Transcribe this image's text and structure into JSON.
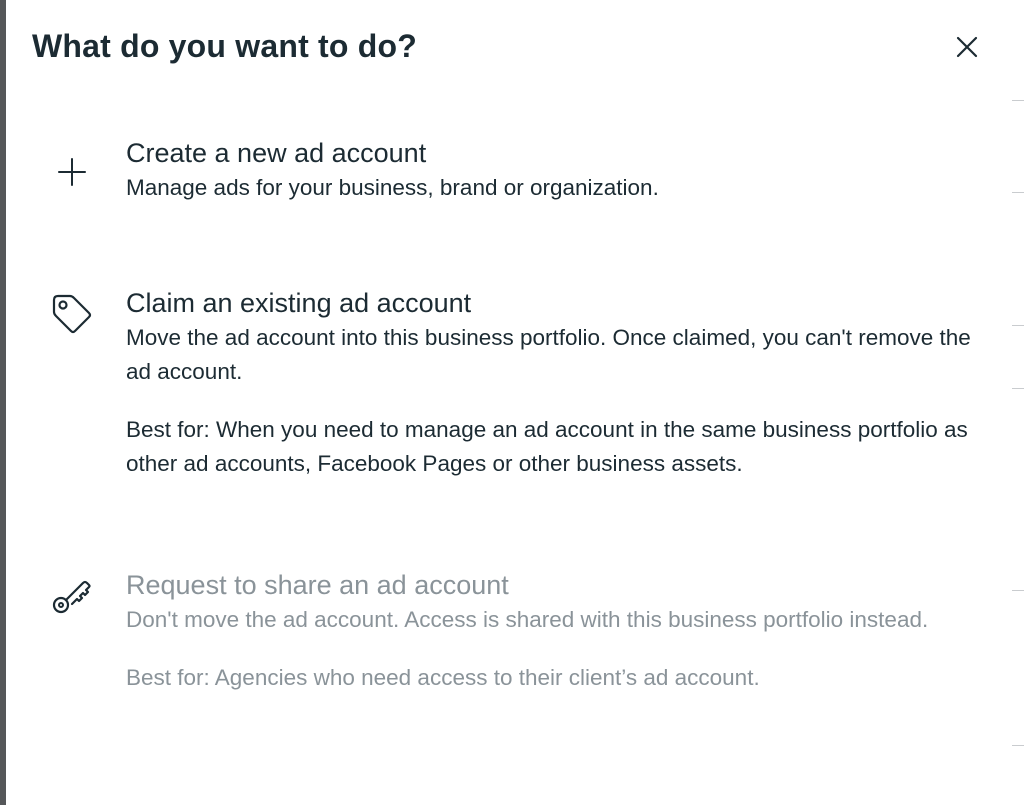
{
  "dialog": {
    "title": "What do you want to do?",
    "close_icon": "close-icon"
  },
  "options": [
    {
      "icon": "plus-icon",
      "title": "Create a new ad account",
      "description": "Manage ads for your business, brand or organization.",
      "enabled": true
    },
    {
      "icon": "tag-icon",
      "title": "Claim an existing ad account",
      "description": "Move the ad account into this business portfolio. Once claimed, you can't remove the ad account.",
      "best_for": "Best for: When you need to manage an ad account in the same business portfolio as other ad accounts, Facebook Pages or other business assets.",
      "enabled": true
    },
    {
      "icon": "key-icon",
      "title": "Request to share an ad account",
      "description": "Don't move the ad account. Access is shared with this business portfolio instead.",
      "best_for": "Best for: Agencies who need access to their client’s ad account.",
      "enabled": false
    }
  ],
  "colors": {
    "text": "#1c2b33",
    "disabled_text": "#8a9399",
    "backdrop": "#555759"
  }
}
